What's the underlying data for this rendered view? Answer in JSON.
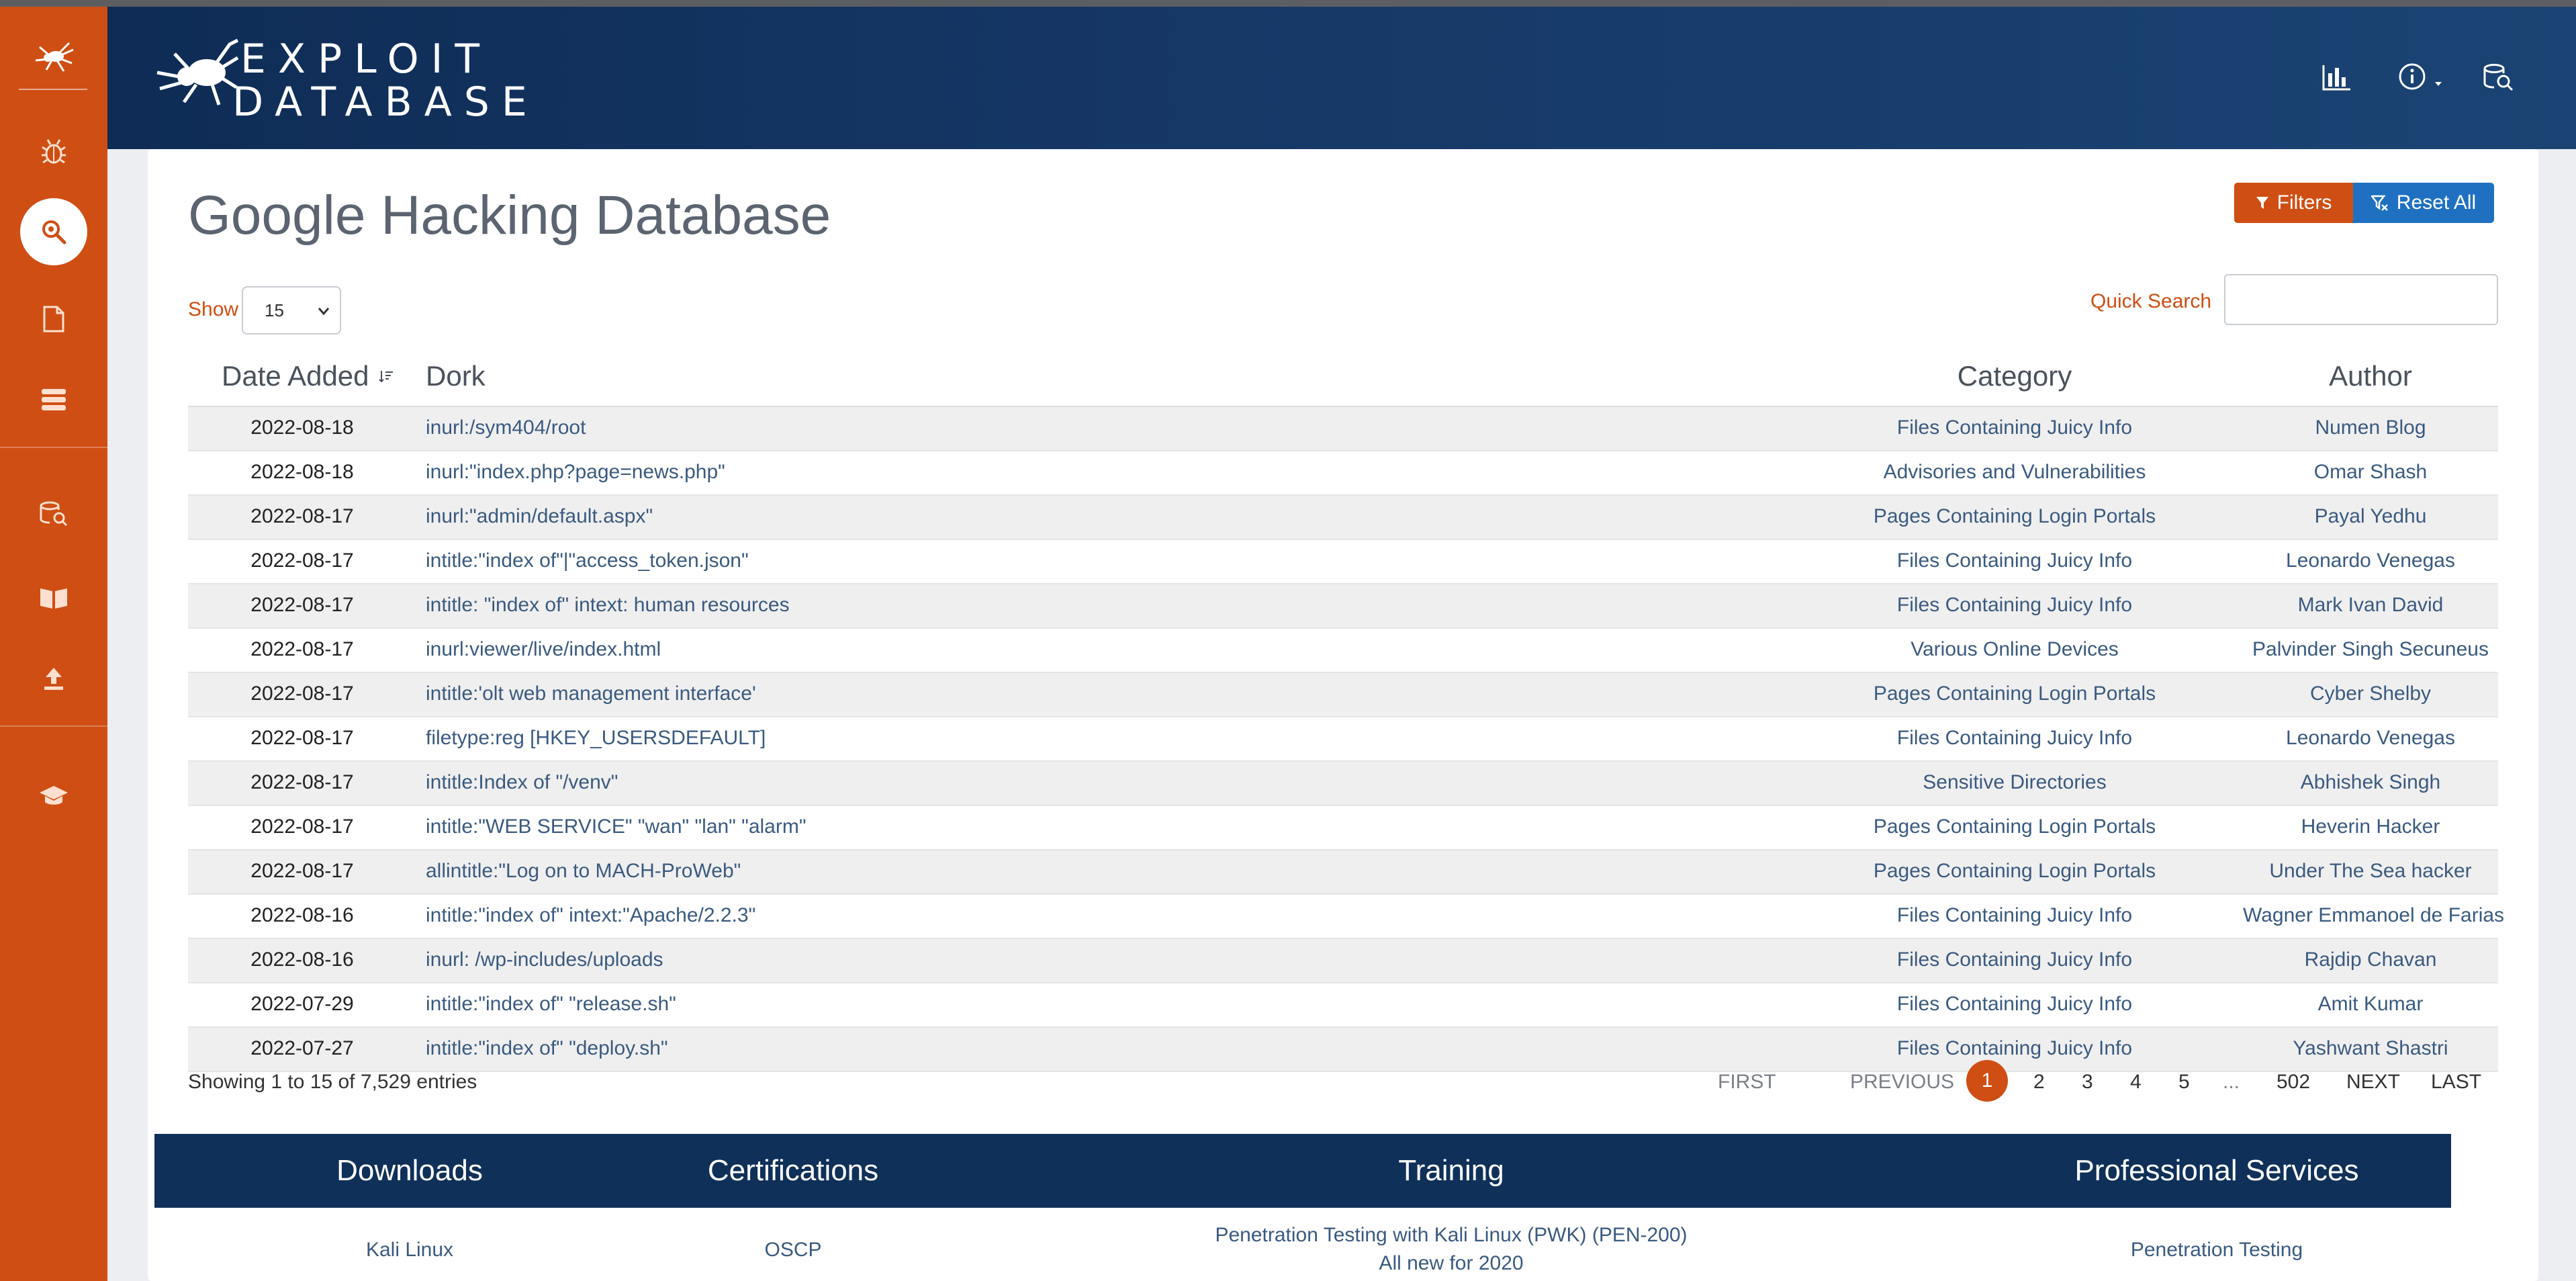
{
  "brand": {
    "logo_line1": "EXPLOIT",
    "logo_line2": "DATABASE",
    "accent": "#cf4e14",
    "header_color": "#163867",
    "link_color": "#3a5a80",
    "reset_color": "#1f70c1"
  },
  "sidebar": {
    "icons": [
      "spider-logo-icon",
      "bug-icon",
      "search-icon",
      "document-icon",
      "database-icon",
      "search-database-icon",
      "book-icon",
      "upload-icon",
      "graduation-cap-icon"
    ],
    "active": "search-icon"
  },
  "header_icons": [
    "stats-icon",
    "info-icon",
    "search-database-icon"
  ],
  "page": {
    "title": "Google Hacking Database",
    "filters_label": "Filters",
    "reset_label": "Reset All",
    "show_label": "Show",
    "show_value": "15",
    "quick_search_label": "Quick Search",
    "quick_search_value": ""
  },
  "table": {
    "headers": {
      "date": "Date Added",
      "dork": "Dork",
      "category": "Category",
      "author": "Author"
    },
    "rows": [
      {
        "date": "2022-08-18",
        "dork": "inurl:/sym404/root",
        "category": "Files Containing Juicy Info",
        "author": "Numen Blog"
      },
      {
        "date": "2022-08-18",
        "dork": "inurl:\"index.php?page=news.php\"",
        "category": "Advisories and Vulnerabilities",
        "author": "Omar Shash"
      },
      {
        "date": "2022-08-17",
        "dork": "inurl:\"admin/default.aspx\"",
        "category": "Pages Containing Login Portals",
        "author": "Payal Yedhu"
      },
      {
        "date": "2022-08-17",
        "dork": "intitle:\"index of\"|\"access_token.json\"",
        "category": "Files Containing Juicy Info",
        "author": "Leonardo Venegas"
      },
      {
        "date": "2022-08-17",
        "dork": "intitle: \"index of\" intext: human resources",
        "category": "Files Containing Juicy Info",
        "author": "Mark Ivan David"
      },
      {
        "date": "2022-08-17",
        "dork": "inurl:viewer/live/index.html",
        "category": "Various Online Devices",
        "author": "Palvinder Singh Secuneus"
      },
      {
        "date": "2022-08-17",
        "dork": "intitle:'olt web management interface'",
        "category": "Pages Containing Login Portals",
        "author": "Cyber Shelby"
      },
      {
        "date": "2022-08-17",
        "dork": "filetype:reg [HKEY_USERSDEFAULT]",
        "category": "Files Containing Juicy Info",
        "author": "Leonardo Venegas"
      },
      {
        "date": "2022-08-17",
        "dork": "intitle:Index of \"/venv\"",
        "category": "Sensitive Directories",
        "author": "Abhishek Singh"
      },
      {
        "date": "2022-08-17",
        "dork": "intitle:\"WEB SERVICE\" \"wan\" \"lan\" \"alarm\"",
        "category": "Pages Containing Login Portals",
        "author": "Heverin Hacker"
      },
      {
        "date": "2022-08-17",
        "dork": "allintitle:\"Log on to MACH-ProWeb\"",
        "category": "Pages Containing Login Portals",
        "author": "Under The Sea hacker"
      },
      {
        "date": "2022-08-16",
        "dork": "intitle:\"index of\" intext:\"Apache/2.2.3\"",
        "category": "Files Containing Juicy Info",
        "author": "Wagner Emmanoel de Farias"
      },
      {
        "date": "2022-08-16",
        "dork": "inurl: /wp-includes/uploads",
        "category": "Files Containing Juicy Info",
        "author": "Rajdip Chavan"
      },
      {
        "date": "2022-07-29",
        "dork": "intitle:\"index of\" \"release.sh\"",
        "category": "Files Containing Juicy Info",
        "author": "Amit Kumar"
      },
      {
        "date": "2022-07-27",
        "dork": "intitle:\"index of\" \"deploy.sh\"",
        "category": "Files Containing Juicy Info",
        "author": "Yashwant Shastri"
      }
    ]
  },
  "entries_info": "Showing 1 to 15 of 7,529 entries",
  "pagination": {
    "first": "FIRST",
    "previous": "PREVIOUS",
    "current": "1",
    "p2": "2",
    "p3": "3",
    "p4": "4",
    "p5": "5",
    "ellipsis": "...",
    "last_page": "502",
    "next": "NEXT",
    "last": "LAST"
  },
  "footer": {
    "downloads": {
      "heading": "Downloads",
      "link": "Kali Linux"
    },
    "certifications": {
      "heading": "Certifications",
      "link": "OSCP"
    },
    "training": {
      "heading": "Training",
      "link_line1": "Penetration Testing with Kali Linux (PWK) (PEN-200)",
      "link_line2": "All new for 2020"
    },
    "services": {
      "heading": "Professional Services",
      "link": "Penetration Testing"
    }
  }
}
